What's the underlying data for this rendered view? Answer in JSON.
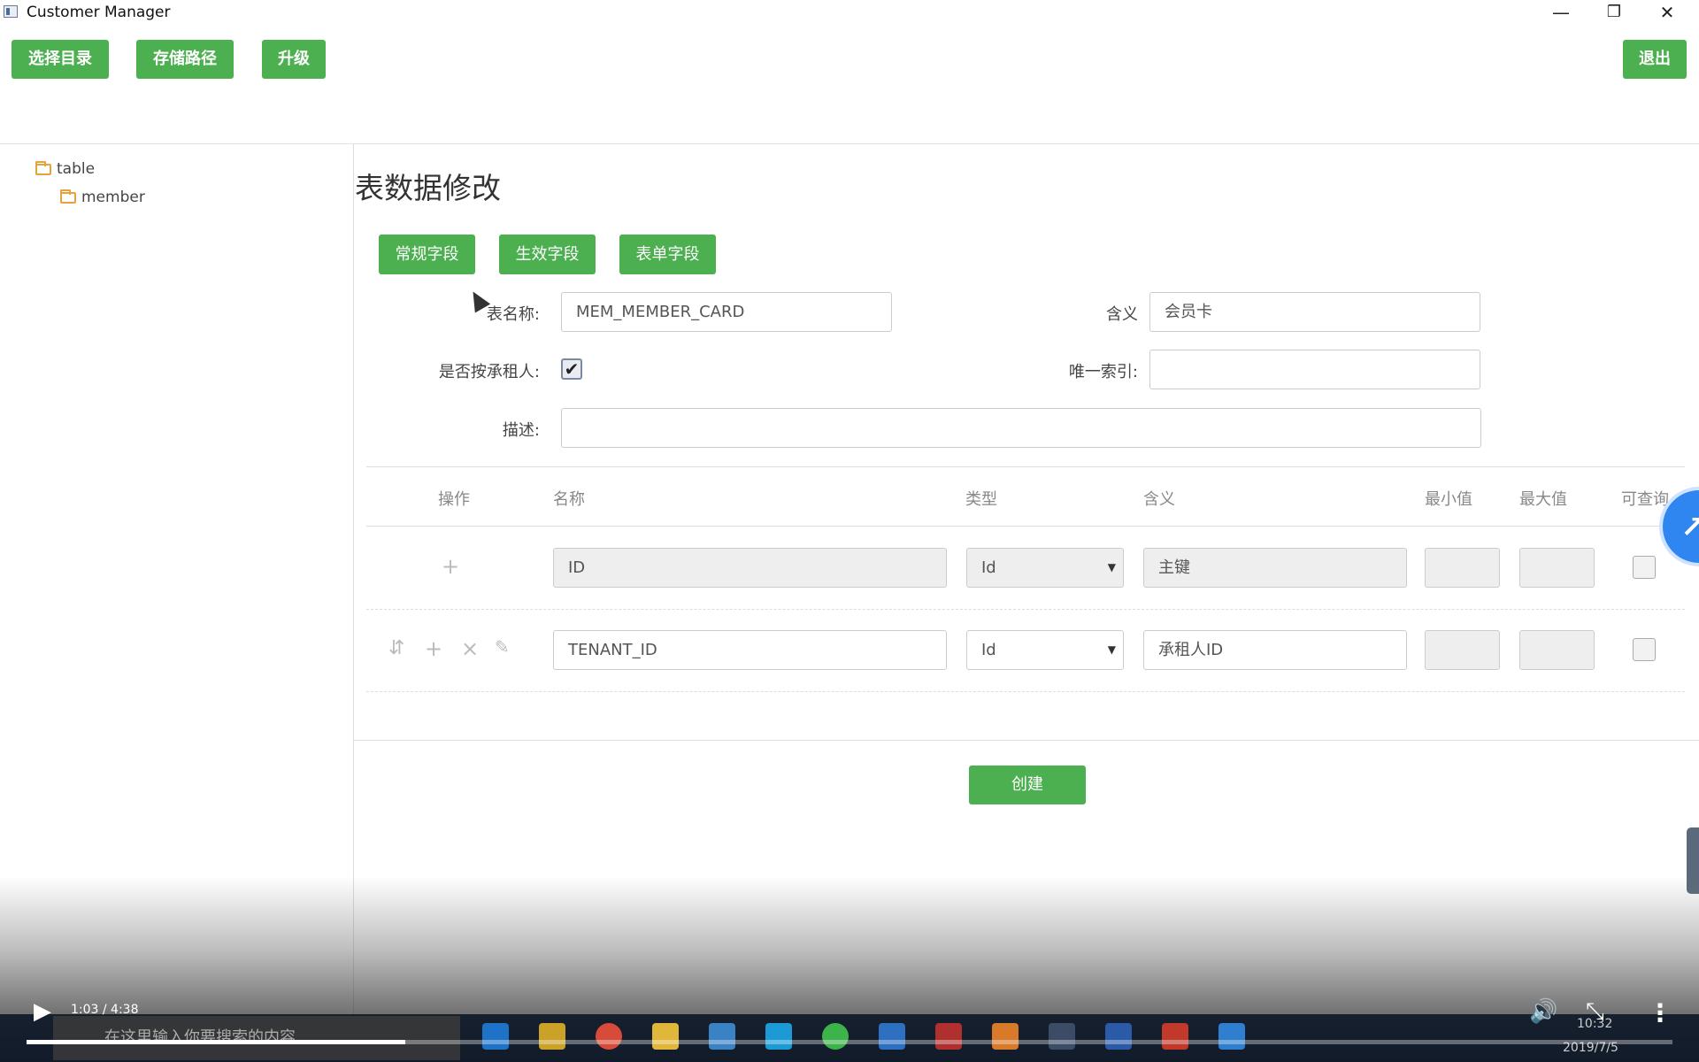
{
  "window": {
    "title": "Customer Manager",
    "minimize_glyph": "—",
    "restore_glyph": "❐",
    "close_glyph": "✕"
  },
  "toolbar": {
    "select_dir": "选择目录",
    "storage_path": "存储路径",
    "upgrade": "升级",
    "exit": "退出"
  },
  "sidebar": {
    "root": "table",
    "child": "member"
  },
  "main": {
    "title": "表数据修改",
    "tabs": [
      "常规字段",
      "生效字段",
      "表单字段"
    ],
    "form": {
      "table_name_label": "表名称:",
      "table_name_value": "MEM_MEMBER_CARD",
      "meaning_label": "含义",
      "meaning_value": "会员卡",
      "tenant_label": "是否按承租人:",
      "tenant_checked": true,
      "unique_index_label": "唯一索引:",
      "unique_index_value": "",
      "desc_label": "描述:",
      "desc_value": ""
    },
    "table": {
      "headers": [
        "操作",
        "名称",
        "类型",
        "含义",
        "最小值",
        "最大值",
        "可查询"
      ],
      "rows": [
        {
          "name": "ID",
          "type": "Id",
          "meaning": "主键",
          "readonly": true
        },
        {
          "name": "TENANT_ID",
          "type": "Id",
          "meaning": "承租人ID",
          "readonly": false
        }
      ]
    },
    "create_button": "创建"
  },
  "video": {
    "time": "1:03 / 4:38",
    "progress": 0.23
  },
  "taskbar": {
    "search_placeholder": "在这里输入你要搜索的内容",
    "clock_time": "10:32",
    "clock_date": "2019/7/5"
  },
  "colors": {
    "accent": "#4caf50",
    "badge": "#2f86f0"
  }
}
